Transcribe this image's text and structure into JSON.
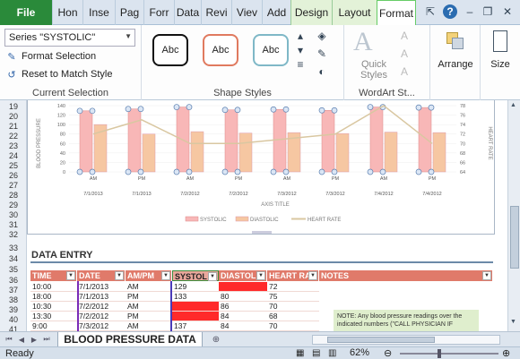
{
  "tabs": {
    "file": "File",
    "items": [
      "Hon",
      "Inse",
      "Pag",
      "Forr",
      "Data",
      "Revi",
      "Viev",
      "Add"
    ],
    "context": [
      "Design",
      "Layout",
      "Format"
    ],
    "active": "Format"
  },
  "ribbon": {
    "current_selection": {
      "series_value": "Series \"SYSTOLIC\"",
      "format_selection": "Format Selection",
      "reset_to_match_style": "Reset to Match Style",
      "label": "Current Selection"
    },
    "shape_styles": {
      "samples": [
        "Abc",
        "Abc",
        "Abc"
      ],
      "label": "Shape Styles"
    },
    "wordart": {
      "quick_styles": "Quick Styles",
      "label": "WordArt St..."
    },
    "arrange": "Arrange",
    "size": "Size"
  },
  "rows": {
    "chart_rows": [
      "19",
      "20",
      "21",
      "22",
      "23",
      "24",
      "25",
      "26",
      "27",
      "28",
      "29",
      "30",
      "31",
      "32"
    ],
    "table_rows": [
      "33",
      "34",
      "35",
      "36",
      "37",
      "38",
      "39",
      "40",
      "41"
    ]
  },
  "chart_data": {
    "type": "bar",
    "categories": [
      "7/1/2013",
      "7/1/2013",
      "7/2/2012",
      "7/2/2012",
      "7/3/2012",
      "7/3/2012",
      "7/4/2012",
      "7/4/2012"
    ],
    "category_sublabels": [
      "AM",
      "PM",
      "AM",
      "PM",
      "AM",
      "PM",
      "AM",
      "PM"
    ],
    "series": [
      {
        "name": "SYSTOLIC",
        "values": [
          129,
          133,
          137,
          131,
          132,
          130,
          137,
          136
        ],
        "axis": "left"
      },
      {
        "name": "DIASTOLIC",
        "values": [
          100,
          80,
          85,
          82,
          83,
          81,
          84,
          83
        ],
        "axis": "left"
      },
      {
        "name": "HEART RATE",
        "values": [
          72,
          75,
          70,
          70,
          71,
          72,
          78,
          70
        ],
        "axis": "right",
        "kind": "line"
      }
    ],
    "y_left_ticks": [
      "0",
      "20",
      "40",
      "60",
      "80",
      "100",
      "120",
      "140"
    ],
    "y_right_ticks": [
      "64",
      "66",
      "68",
      "70",
      "72",
      "74",
      "76",
      "78"
    ],
    "ylim_left": [
      0,
      140
    ],
    "ylim_right": [
      64,
      78
    ],
    "ylabel_left": "BLOOD PRESSURE",
    "ylabel_right": "HEART RATE",
    "xlabel": "AXIS TITLE",
    "legend_placement": "bottom",
    "colors": {
      "systolic": "#f8b7b7",
      "diastolic": "#f6c7a2",
      "heart_rate": "#d9c7a1"
    }
  },
  "data_entry": {
    "title": "DATA ENTRY",
    "headers": [
      "TIME",
      "DATE",
      "AM/PM",
      "SYSTOL",
      "DIASTOL",
      "HEART RA",
      "NOTES"
    ],
    "rows": [
      [
        "10:00",
        "7/1/2013",
        "AM",
        "129",
        "",
        "72"
      ],
      [
        "18:00",
        "7/1/2013",
        "PM",
        "133",
        "80",
        "75"
      ],
      [
        "10:30",
        "7/2/2012",
        "AM",
        "",
        "86",
        "70"
      ],
      [
        "13:30",
        "7/2/2012",
        "PM",
        "",
        "84",
        "68"
      ],
      [
        "9:00",
        "7/3/2012",
        "AM",
        "137",
        "84",
        "70"
      ]
    ],
    "note": "NOTE: Any blood pressure readings over the indicated numbers (\"CALL PHYSICIAN IF"
  },
  "sheet_tab": "BLOOD PRESSURE DATA",
  "status": {
    "ready": "Ready",
    "zoom": "62%"
  }
}
